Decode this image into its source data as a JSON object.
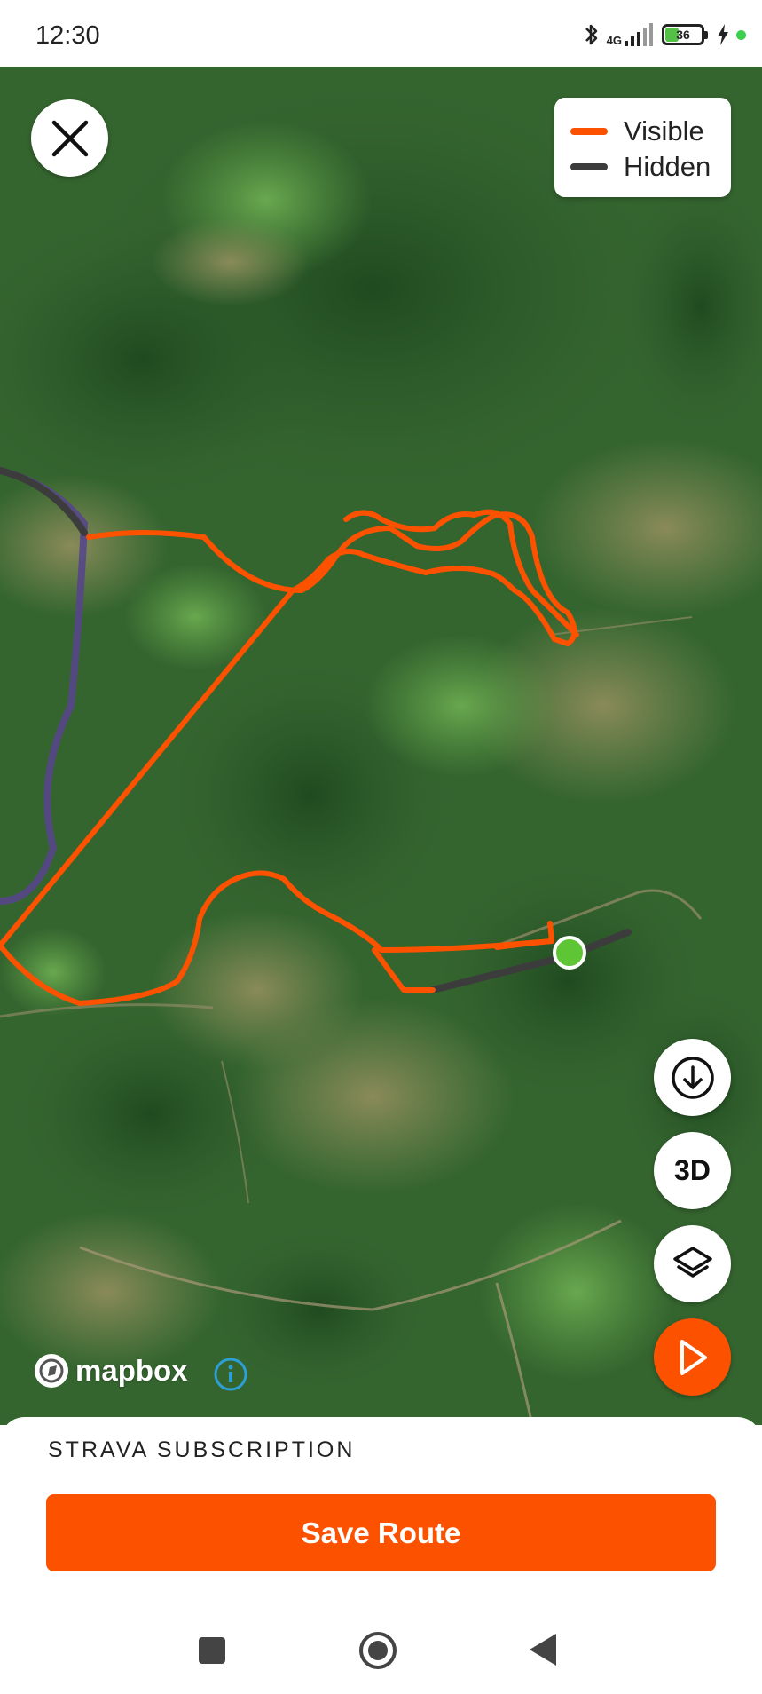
{
  "status_bar": {
    "time": "12:30",
    "network": "4G",
    "battery": "36"
  },
  "map": {
    "legend": {
      "visible_label": "Visible",
      "hidden_label": "Hidden",
      "visible_color": "#fc5200",
      "hidden_color": "#3c3c3c"
    },
    "attribution": "mapbox",
    "buttons": {
      "download_icon": "download-circle-icon",
      "three_d_label": "3D",
      "layers_icon": "layers-icon",
      "play_icon": "play-icon"
    }
  },
  "bottom_sheet": {
    "subscription_label": "STRAVA SUBSCRIPTION",
    "save_label": "Save Route"
  },
  "nav_bar": {
    "items": [
      "recents-square-icon",
      "home-circle-icon",
      "back-triangle-icon"
    ]
  },
  "colors": {
    "accent": "#fc5200",
    "start_marker": "#5ec634"
  }
}
